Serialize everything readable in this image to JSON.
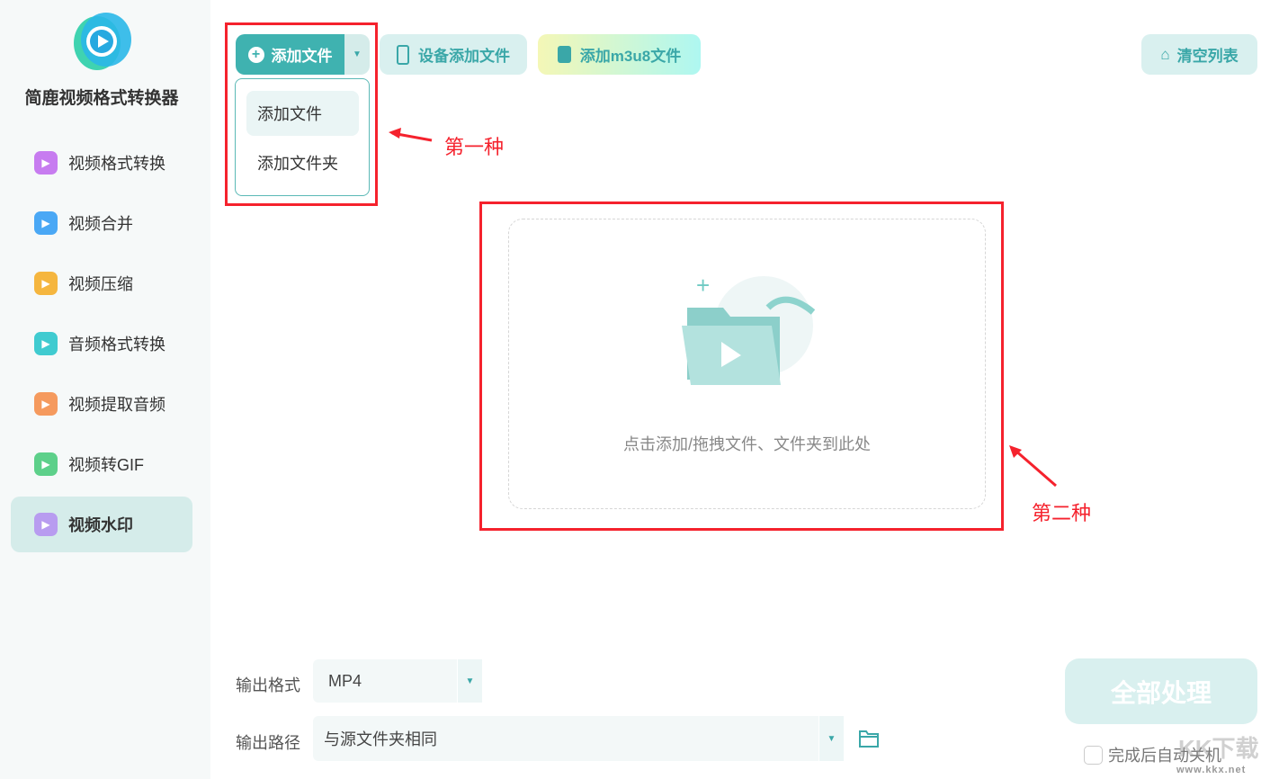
{
  "app": {
    "title": "简鹿视频格式转换器"
  },
  "sidebar": {
    "items": [
      {
        "label": "视频格式转换",
        "icon": "convert-icon",
        "color": "#c77cf0"
      },
      {
        "label": "视频合并",
        "icon": "merge-icon",
        "color": "#4aa8f5"
      },
      {
        "label": "视频压缩",
        "icon": "compress-icon",
        "color": "#f5b63f"
      },
      {
        "label": "音频格式转换",
        "icon": "music-icon",
        "color": "#40cbd0"
      },
      {
        "label": "视频提取音频",
        "icon": "extract-audio-icon",
        "color": "#f59a5e"
      },
      {
        "label": "视频转GIF",
        "icon": "gif-icon",
        "color": "#5dd08a"
      },
      {
        "label": "视频水印",
        "icon": "watermark-icon",
        "color": "#b89cf0"
      }
    ]
  },
  "toolbar": {
    "add_file": "添加文件",
    "device_add": "设备添加文件",
    "add_m3u8": "添加m3u8文件",
    "clear_list": "清空列表"
  },
  "dropdown": {
    "items": [
      "添加文件",
      "添加文件夹"
    ]
  },
  "annotations": {
    "first": "第一种",
    "second": "第二种"
  },
  "dropzone": {
    "hint": "点击添加/拖拽文件、文件夹到此处"
  },
  "output": {
    "format_label": "输出格式",
    "format_value": "MP4",
    "path_label": "输出路径",
    "path_value": "与源文件夹相同"
  },
  "actions": {
    "process_all": "全部处理",
    "auto_shutdown": "完成后自动关机",
    "auto_shutdown_checked": false
  },
  "watermark": {
    "text": "KK下载",
    "url": "www.kkx.net"
  }
}
